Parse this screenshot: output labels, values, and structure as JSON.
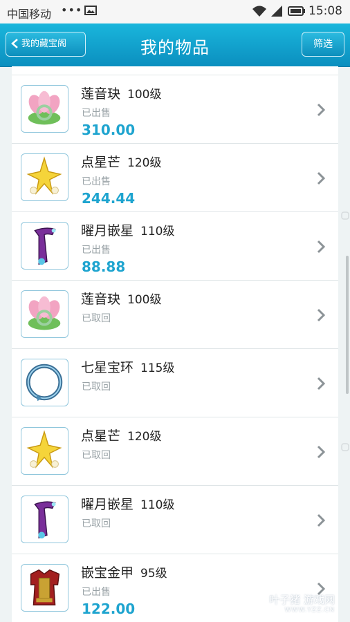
{
  "status_bar": {
    "carrier": "中国移动",
    "dots": "•••",
    "time": "15:08"
  },
  "header": {
    "back_label": "我的藏宝阁",
    "title": "我的物品",
    "filter_label": "筛选"
  },
  "items": [
    {
      "name": "莲音玦",
      "level": "100级",
      "status": "已出售",
      "price": "310.00",
      "icon": "lotus-pendant-icon"
    },
    {
      "name": "点星芒",
      "level": "120级",
      "status": "已出售",
      "price": "244.44",
      "icon": "gold-earring-icon"
    },
    {
      "name": "曜月嵌星",
      "level": "110级",
      "status": "已出售",
      "price": "88.88",
      "icon": "purple-staff-icon"
    },
    {
      "name": "莲音玦",
      "level": "100级",
      "status": "已取回",
      "price": "",
      "icon": "lotus-pendant-icon"
    },
    {
      "name": "七星宝环",
      "level": "115级",
      "status": "已取回",
      "price": "",
      "icon": "blue-ring-icon"
    },
    {
      "name": "点星芒",
      "level": "120级",
      "status": "已取回",
      "price": "",
      "icon": "gold-earring-icon"
    },
    {
      "name": "曜月嵌星",
      "level": "110级",
      "status": "已取回",
      "price": "",
      "icon": "purple-staff-icon"
    },
    {
      "name": "嵌宝金甲",
      "level": "95级",
      "status": "已出售",
      "price": "122.00",
      "icon": "gold-armor-icon"
    }
  ],
  "watermark": {
    "line1": "叶子猪",
    "line2": "游戏网",
    "line3": "WWW.YZZ.CN"
  },
  "colors": {
    "header": "#0b8fbf",
    "price": "#1ea4cf"
  }
}
